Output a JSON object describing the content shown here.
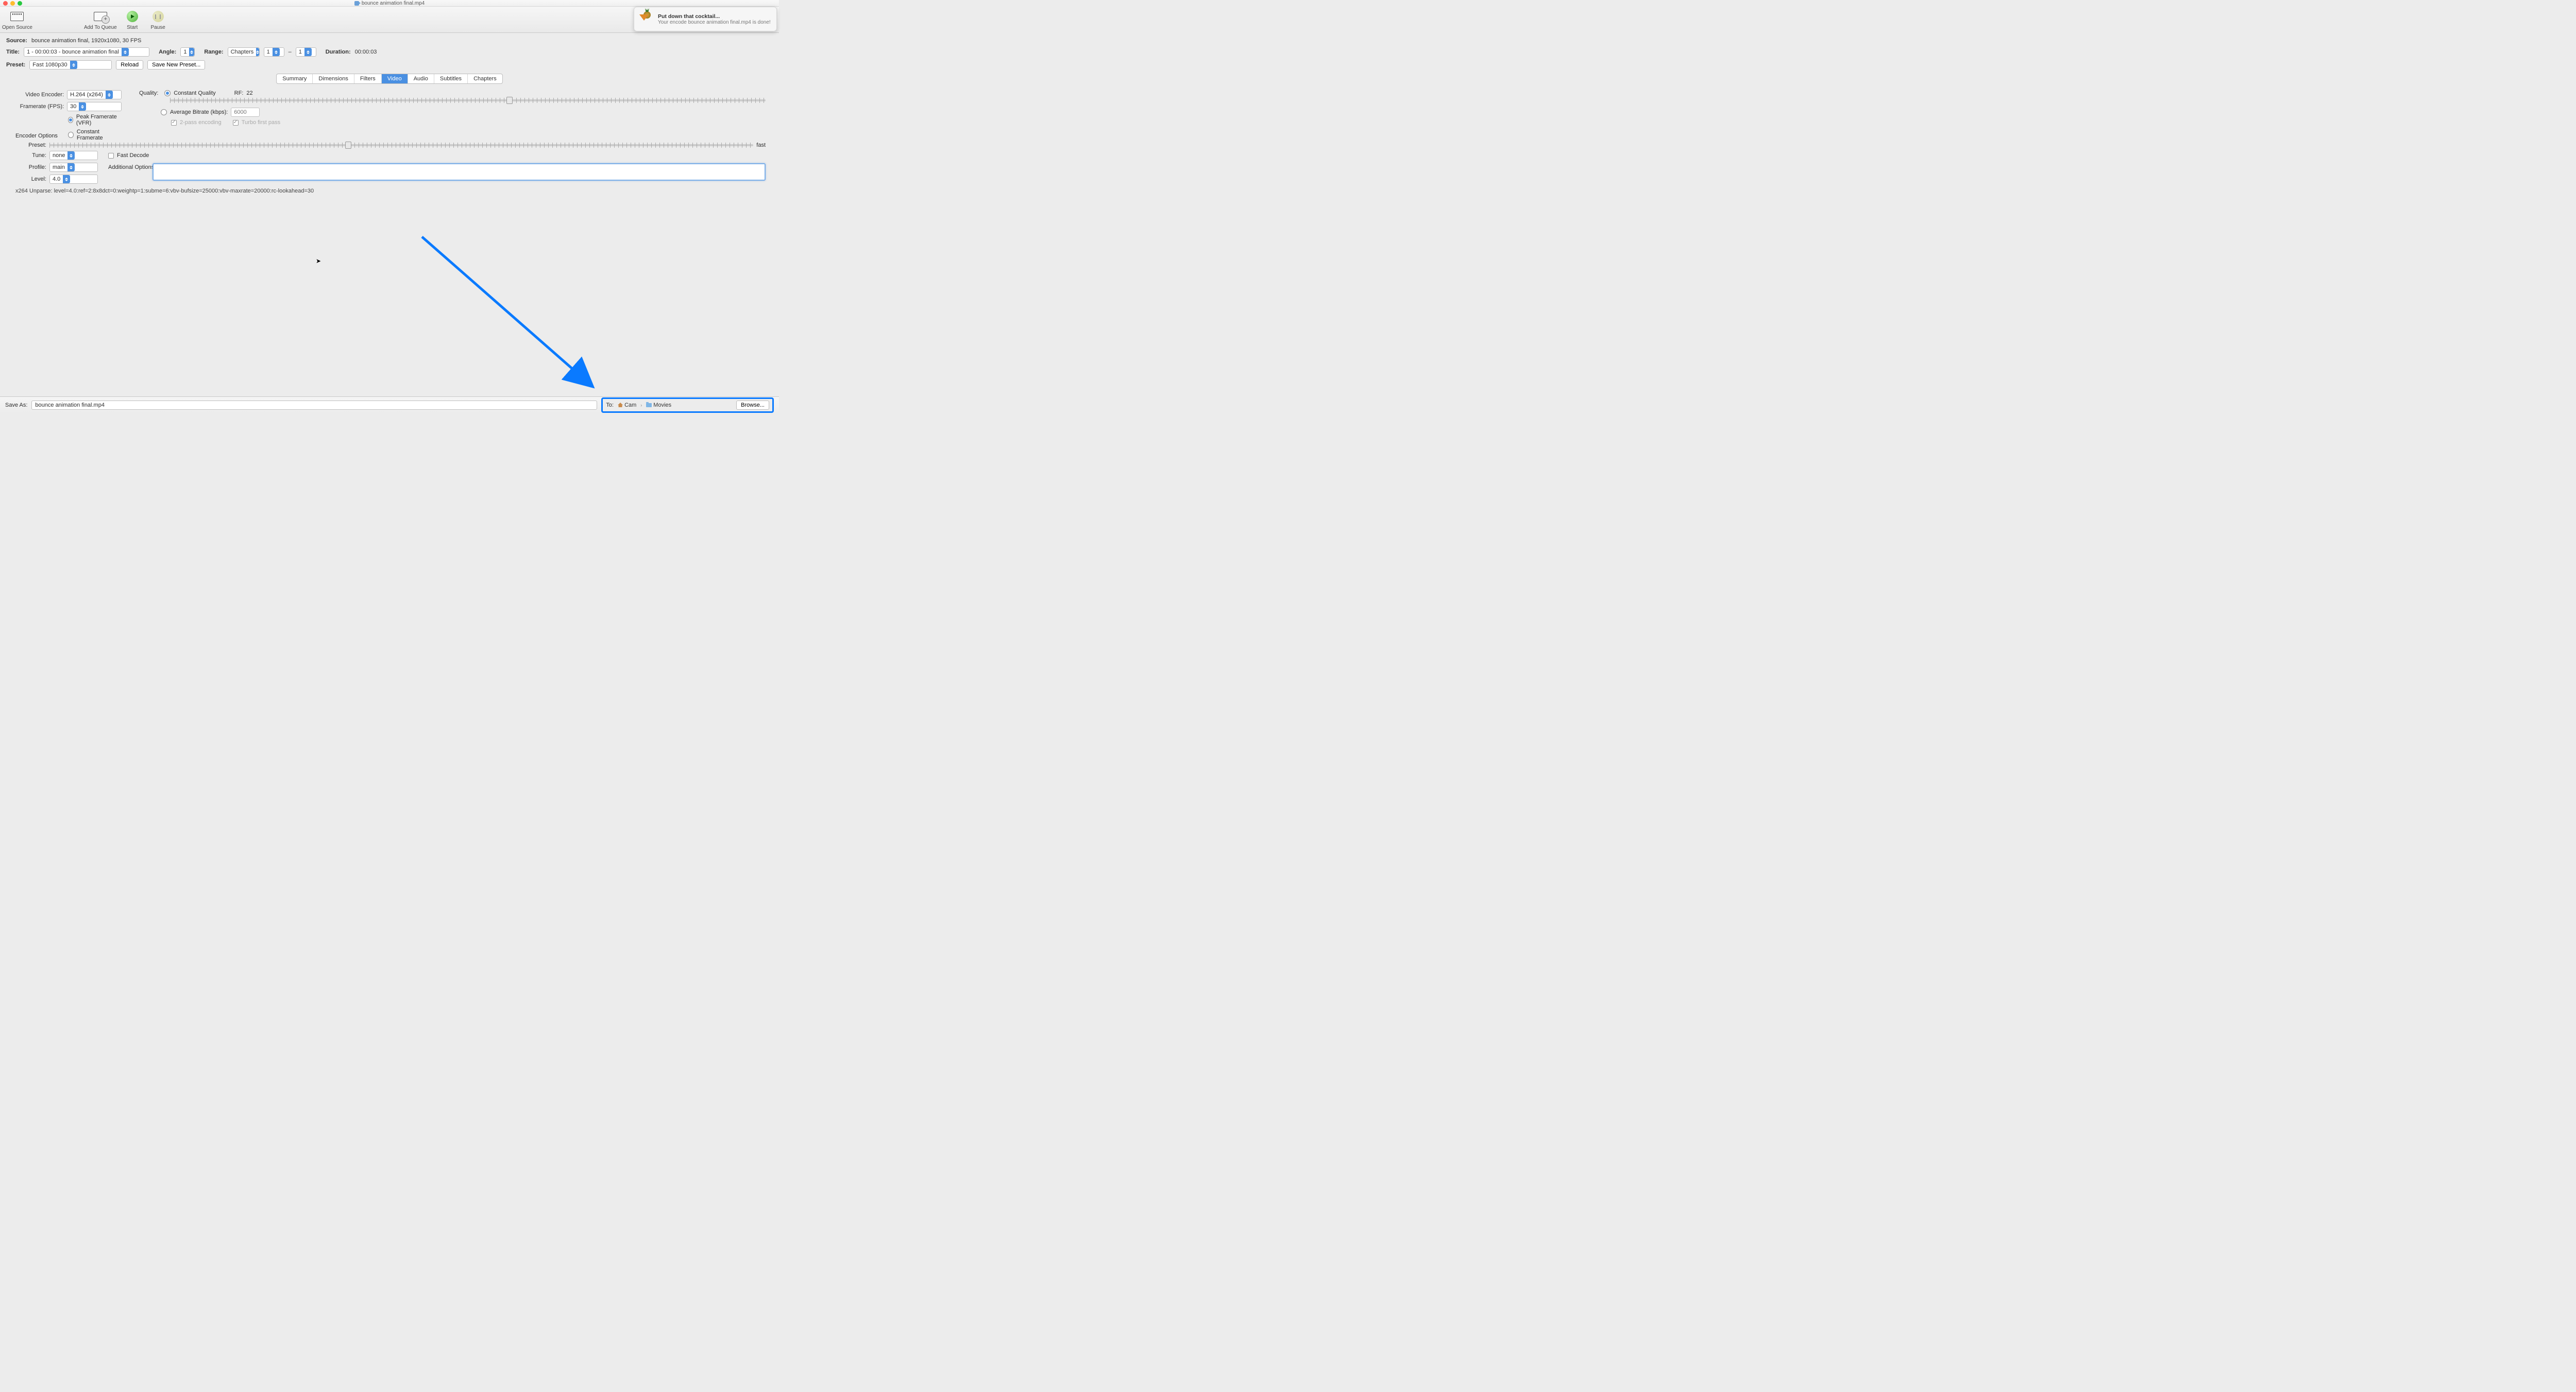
{
  "window": {
    "title": "bounce animation final.mp4"
  },
  "toolbar": {
    "open_source": "Open Source",
    "add_queue": "Add To Queue",
    "start": "Start",
    "pause": "Pause"
  },
  "source": {
    "label": "Source:",
    "value": "bounce animation final, 1920x1080, 30 FPS"
  },
  "title_row": {
    "label": "Title:",
    "value": "1 - 00:00:03 - bounce animation final",
    "angle_label": "Angle:",
    "angle": "1",
    "range_label": "Range:",
    "range_type": "Chapters",
    "from": "1",
    "dash": "–",
    "to": "1",
    "duration_label": "Duration:",
    "duration": "00:00:03"
  },
  "preset_row": {
    "label": "Preset:",
    "value": "Fast 1080p30",
    "reload": "Reload",
    "save_new": "Save New Preset..."
  },
  "tabs": [
    "Summary",
    "Dimensions",
    "Filters",
    "Video",
    "Audio",
    "Subtitles",
    "Chapters"
  ],
  "active_tab": "Video",
  "video": {
    "encoder_label": "Video Encoder:",
    "encoder": "H.264 (x264)",
    "fps_label": "Framerate (FPS):",
    "fps": "30",
    "peak_vfr": "Peak Framerate (VFR)",
    "const_fr": "Constant Framerate",
    "quality_label": "Quality:",
    "cq": "Constant Quality",
    "rf_label": "RF:",
    "rf": "22",
    "abr": "Average Bitrate (kbps):",
    "abr_value": "6000",
    "two_pass": "2-pass encoding",
    "turbo": "Turbo first pass",
    "encoder_options_header": "Encoder Options",
    "preset_label": "Preset:",
    "preset_speed": "fast",
    "tune_label": "Tune:",
    "tune": "none",
    "fast_decode": "Fast Decode",
    "profile_label": "Profile:",
    "profile": "main",
    "level_label": "Level:",
    "level": "4.0",
    "additional_label": "Additional Options:",
    "unparse": "x264 Unparse: level=4.0:ref=2:8x8dct=0:weightp=1:subme=6:vbv-bufsize=25000:vbv-maxrate=20000:rc-lookahead=30"
  },
  "bottom": {
    "saveas_label": "Save As:",
    "saveas_value": "bounce animation final.mp4",
    "to_label": "To:",
    "path_user": "Cam",
    "path_folder": "Movies",
    "browse": "Browse..."
  },
  "notification": {
    "title": "Put down that cocktail...",
    "subtitle": "Your encode bounce animation final.mp4 is done!"
  }
}
